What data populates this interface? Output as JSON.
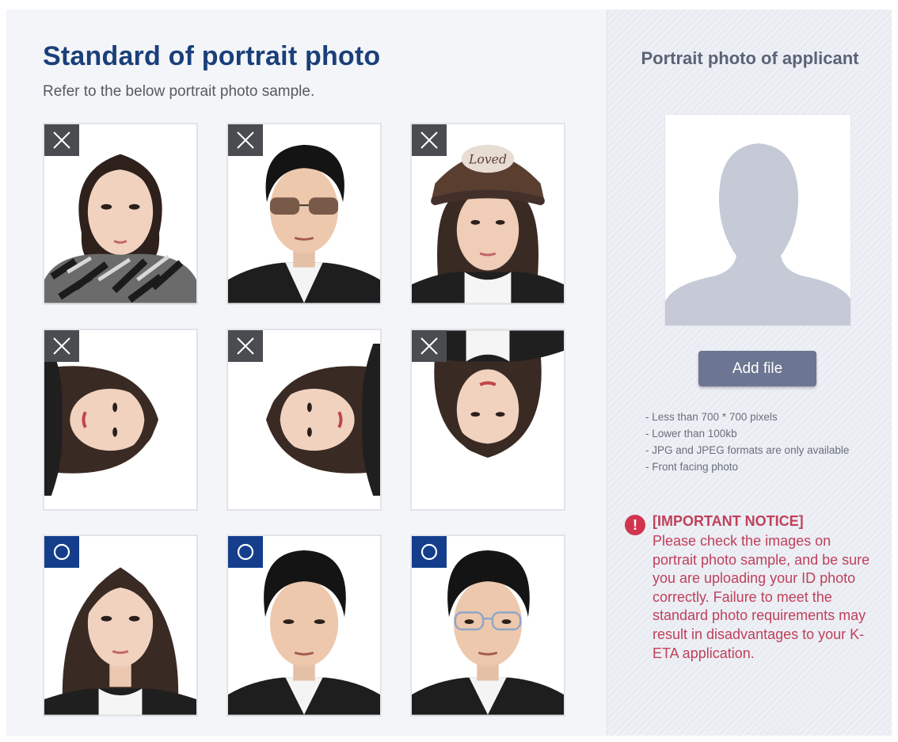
{
  "left": {
    "title": "Standard of portrait photo",
    "subtitle": "Refer to the below portrait photo sample."
  },
  "photos": [
    {
      "row": 1,
      "col": 1,
      "status": "rejected",
      "mark_icon": "x-icon",
      "subject": "woman-wearing-scarf",
      "orientation": "upright"
    },
    {
      "row": 1,
      "col": 2,
      "status": "rejected",
      "mark_icon": "x-icon",
      "subject": "man-wearing-sunglasses",
      "orientation": "upright"
    },
    {
      "row": 1,
      "col": 3,
      "status": "rejected",
      "mark_icon": "x-icon",
      "subject": "woman-wearing-cap",
      "orientation": "upright"
    },
    {
      "row": 2,
      "col": 1,
      "status": "rejected",
      "mark_icon": "x-icon",
      "subject": "woman-rotated",
      "orientation": "rotated-right"
    },
    {
      "row": 2,
      "col": 2,
      "status": "rejected",
      "mark_icon": "x-icon",
      "subject": "woman-rotated",
      "orientation": "rotated-left"
    },
    {
      "row": 2,
      "col": 3,
      "status": "rejected",
      "mark_icon": "x-icon",
      "subject": "woman-upside-down",
      "orientation": "upside-down"
    },
    {
      "row": 3,
      "col": 1,
      "status": "accepted",
      "mark_icon": "o-icon",
      "subject": "woman-front-facing",
      "orientation": "upright"
    },
    {
      "row": 3,
      "col": 2,
      "status": "accepted",
      "mark_icon": "o-icon",
      "subject": "man-front-facing",
      "orientation": "upright"
    },
    {
      "row": 3,
      "col": 3,
      "status": "accepted",
      "mark_icon": "o-icon",
      "subject": "man-with-glasses",
      "orientation": "upright"
    }
  ],
  "right": {
    "title": "Portrait photo of applicant",
    "add_file_label": "Add file",
    "requirements": [
      "- Less than 700 * 700 pixels",
      "- Lower than 100kb",
      "- JPG and JPEG formats are only available",
      "- Front facing photo"
    ],
    "notice": {
      "icon": "!",
      "title": "[IMPORTANT NOTICE]",
      "body": "Please check the images on portrait photo sample, and be sure you are uploading your ID photo correctly. Failure to meet the standard photo requirements may result in disadvantages to your K-ETA application."
    }
  },
  "colors": {
    "title_blue": "#1a3f7a",
    "reject_mark": "#4a4c50",
    "accept_mark": "#143d8c",
    "notice_red": "#c0405a",
    "button": "#6c7591",
    "placeholder_silhouette": "#c6cad6"
  }
}
